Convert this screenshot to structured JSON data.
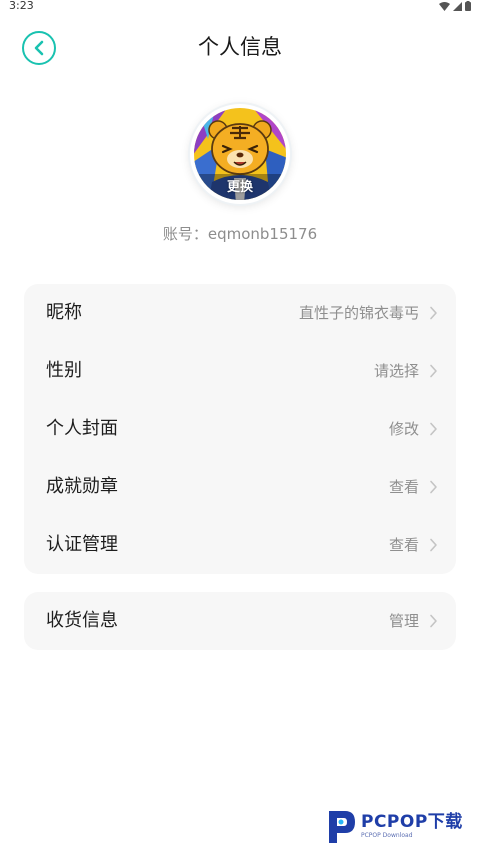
{
  "status_bar": {
    "time": "3:23",
    "icons": [
      "wifi-icon",
      "signal-icon",
      "battery-icon"
    ]
  },
  "header": {
    "title": "个人信息",
    "back_icon": "back-arrow-icon",
    "accent_color": "#19c2b0"
  },
  "profile": {
    "avatar_icon": "tiger-avatar",
    "change_label": "更换",
    "account_text": "账号：eqmonb15176"
  },
  "settings_group": [
    {
      "label": "昵称",
      "value": "直性子的锦衣毒丐"
    },
    {
      "label": "性别",
      "value": "请选择"
    },
    {
      "label": "个人封面",
      "value": "修改"
    },
    {
      "label": "成就勋章",
      "value": "查看"
    },
    {
      "label": "认证管理",
      "value": "查看"
    }
  ],
  "shipping_group": [
    {
      "label": "收货信息",
      "value": "管理"
    }
  ],
  "watermark": {
    "main": "PCPOP下载",
    "sub": "PCPOP Download"
  }
}
